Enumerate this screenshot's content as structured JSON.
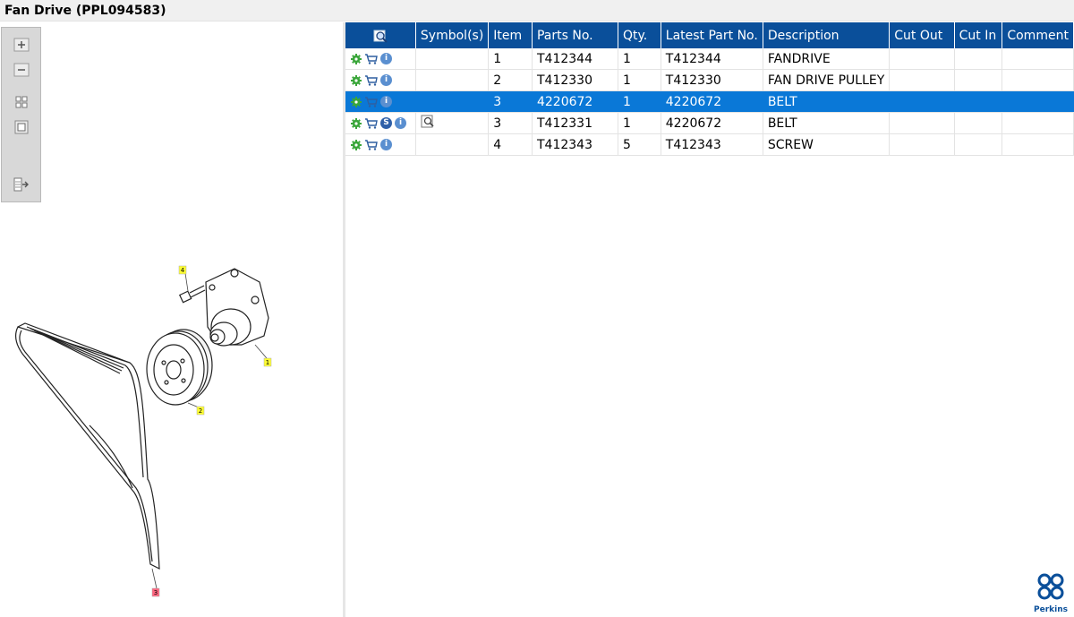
{
  "window": {
    "title": "Fan Drive (PPL094583)"
  },
  "toolbar": {
    "tools": [
      {
        "icon": "zoom-in-icon"
      },
      {
        "icon": "zoom-out-icon"
      },
      {
        "icon": "fit-all-icon"
      },
      {
        "icon": "fit-window-icon"
      },
      {
        "icon": "export-icon"
      }
    ]
  },
  "diagram": {
    "callouts": [
      {
        "label": "4",
        "color": "#ffff33"
      },
      {
        "label": "1",
        "color": "#ffff33"
      },
      {
        "label": "2",
        "color": "#ffff33"
      },
      {
        "label": "3",
        "color": "#ff6680"
      }
    ]
  },
  "table": {
    "columns": [
      "Symbol(s)",
      "Item",
      "Parts No.",
      "Qty.",
      "Latest Part No.",
      "Description",
      "Cut Out",
      "Cut In",
      "Comment"
    ],
    "header_icon": "magnifier-icon",
    "rows": [
      {
        "item": "1",
        "part_no": "T412344",
        "qty": "1",
        "latest": "T412344",
        "description": "FANDRIVE",
        "cut_out": "",
        "cut_in": "",
        "comment": "",
        "badges": [
          "gear",
          "cart",
          "info"
        ],
        "symbol": ""
      },
      {
        "item": "2",
        "part_no": "T412330",
        "qty": "1",
        "latest": "T412330",
        "description": "FAN DRIVE PULLEY",
        "cut_out": "",
        "cut_in": "",
        "comment": "",
        "badges": [
          "gear",
          "cart",
          "info"
        ],
        "symbol": ""
      },
      {
        "item": "3",
        "part_no": "4220672",
        "qty": "1",
        "latest": "4220672",
        "description": "BELT",
        "cut_out": "",
        "cut_in": "",
        "comment": "",
        "badges": [
          "gear",
          "cart",
          "info"
        ],
        "symbol": "",
        "selected": true
      },
      {
        "item": "3",
        "part_no": "T412331",
        "qty": "1",
        "latest": "4220672",
        "description": "BELT",
        "cut_out": "",
        "cut_in": "",
        "comment": "",
        "badges": [
          "gear",
          "cart",
          "s",
          "info"
        ],
        "symbol": "search-doc-icon"
      },
      {
        "item": "4",
        "part_no": "T412343",
        "qty": "5",
        "latest": "T412343",
        "description": "SCREW",
        "cut_out": "",
        "cut_in": "",
        "comment": "",
        "badges": [
          "gear",
          "cart",
          "info"
        ],
        "symbol": ""
      }
    ],
    "badge_s_text": "S",
    "badge_i_text": "i"
  },
  "brand": {
    "name": "Perkins"
  },
  "colors": {
    "header": "#0a4f9a",
    "selected": "#0a78d7",
    "gear": "#3aa63a"
  }
}
